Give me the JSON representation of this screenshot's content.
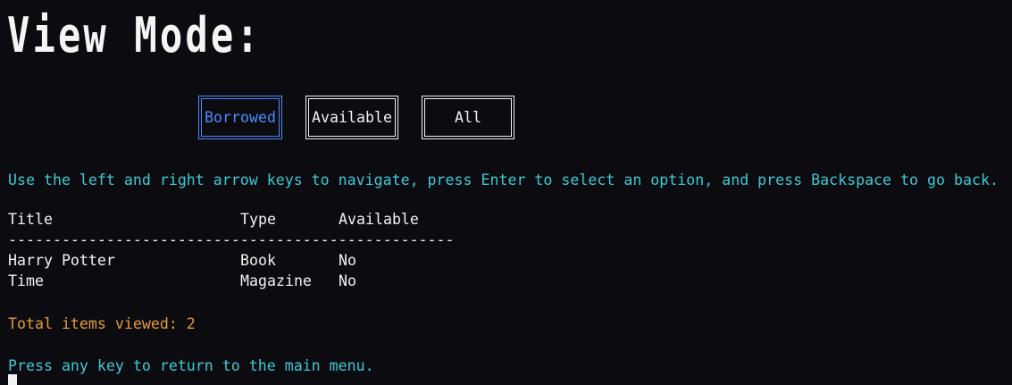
{
  "title": "View Mode:",
  "buttons": [
    {
      "label": "Borrowed",
      "active": true
    },
    {
      "label": "Available",
      "active": false
    },
    {
      "label": "All",
      "active": false
    }
  ],
  "instructions": "Use the left and right arrow keys to navigate, press Enter to select an option, and press Backspace to go back.",
  "table": {
    "headers": [
      "Title",
      "Type",
      "Available"
    ],
    "separator": "--------------------------------------------------",
    "rows": [
      [
        "Harry Potter",
        "Book",
        "No"
      ],
      [
        "Time",
        "Magazine",
        "No"
      ]
    ]
  },
  "total_label": "Total items viewed: 2",
  "footer": "Press any key to return to the main menu.",
  "colors": {
    "background": "#0c0c10",
    "text": "#f2f2f2",
    "cyan": "#3ec8d6",
    "orange": "#e39a3a",
    "active_blue": "#4a8cff"
  }
}
